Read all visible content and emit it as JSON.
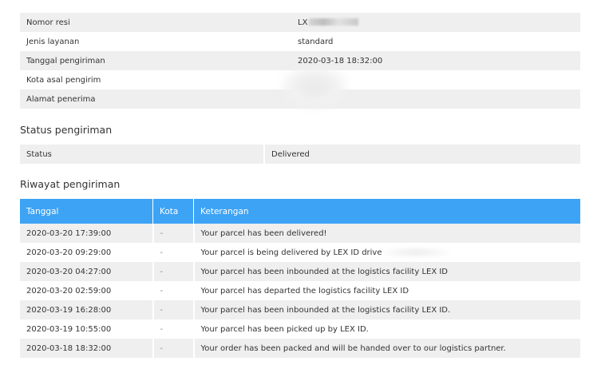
{
  "details": {
    "rows": [
      {
        "label": "Nomor resi",
        "value": "LX"
      },
      {
        "label": "Jenis layanan",
        "value": "standard"
      },
      {
        "label": "Tanggal pengiriman",
        "value": "2020-03-18 18:32:00"
      },
      {
        "label": "Kota asal pengirim",
        "value": ""
      },
      {
        "label": "Alamat penerima",
        "value": ""
      }
    ]
  },
  "status_section": {
    "title": "Status pengiriman",
    "label": "Status",
    "value": "Delivered"
  },
  "history_section": {
    "title": "Riwayat pengiriman",
    "columns": [
      "Tanggal",
      "Kota",
      "Keterangan"
    ],
    "rows": [
      {
        "date": "2020-03-20 17:39:00",
        "city": "-",
        "note": "Your parcel has been delivered!"
      },
      {
        "date": "2020-03-20 09:29:00",
        "city": "-",
        "note": "Your parcel is being delivered by LEX ID drive"
      },
      {
        "date": "2020-03-20 04:27:00",
        "city": "-",
        "note": "Your parcel has been inbounded at the logistics facility LEX ID"
      },
      {
        "date": "2020-03-20 02:59:00",
        "city": "-",
        "note": "Your parcel has departed the logistics facility LEX ID"
      },
      {
        "date": "2020-03-19 16:28:00",
        "city": "-",
        "note": "Your parcel has been inbounded at the logistics facility LEX ID."
      },
      {
        "date": "2020-03-19 10:55:00",
        "city": "-",
        "note": "Your parcel has been picked up by LEX ID."
      },
      {
        "date": "2020-03-18 18:32:00",
        "city": "-",
        "note": "Your order has been packed and will be handed over to our logistics partner."
      }
    ]
  },
  "colors": {
    "header_blue": "#3da3f5",
    "row_alt": "#efefef"
  }
}
